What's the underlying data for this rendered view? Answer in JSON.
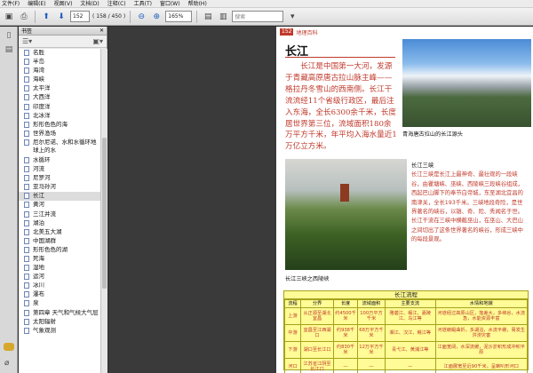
{
  "menu": [
    "文件(F)",
    "编辑(E)",
    "视图(V)",
    "文档(D)",
    "注释(C)",
    "工具(T)",
    "窗口(W)",
    "帮助(H)"
  ],
  "toolbar": {
    "page_current": "152",
    "page_total": "( 158 / 450 )",
    "zoom": "165%",
    "search_placeholder": "搜索"
  },
  "bookmarks_panel": {
    "title": "书签",
    "items": [
      {
        "label": "名胜"
      },
      {
        "label": "半岛"
      },
      {
        "label": "海湾"
      },
      {
        "label": "海峡"
      },
      {
        "label": "太平洋"
      },
      {
        "label": "大西洋"
      },
      {
        "label": "印度洋"
      },
      {
        "label": "北冰洋"
      },
      {
        "label": "形形色色的海"
      },
      {
        "label": "世界渔场"
      },
      {
        "label": "厄尔尼诺、水和水循环地球上的水"
      },
      {
        "label": "水循环"
      },
      {
        "label": "河流"
      },
      {
        "label": "尼罗河"
      },
      {
        "label": "亚马孙河"
      },
      {
        "label": "长江"
      },
      {
        "label": "黄河"
      },
      {
        "label": "三江并流"
      },
      {
        "label": "湖泊"
      },
      {
        "label": "北美五大湖"
      },
      {
        "label": "中国湖群"
      },
      {
        "label": "形形色色的湖"
      },
      {
        "label": "死海"
      },
      {
        "label": "湿地"
      },
      {
        "label": "运河"
      },
      {
        "label": "冰川"
      },
      {
        "label": "瀑布"
      },
      {
        "label": "泉"
      },
      {
        "label": "第四章 天气和气候大气层"
      },
      {
        "label": "太阳辐射"
      },
      {
        "label": "气象观测"
      }
    ]
  },
  "page": {
    "number": "152",
    "section": "地理百科",
    "title": "长江",
    "intro": "长江是中国第一大河，发源于青藏高原唐古拉山脉主峰——格拉丹冬雪山的西南侧。长江干流流经11个省级行政区，最后注入东海，全长6300余千米，长度居世界第三位，流域面积180余万平方千米，年平均入海水量近1万亿立方米。",
    "photo_top_caption": "青海唐古拉山的长江源头",
    "photo_bottom_caption": "长江三峡之西陵峡",
    "three_gorges_heading": "长江三峡",
    "three_gorges_text": "长江三峡是长江上最神奇、最壮观的一段峡谷，由瞿塘峡、巫峡、西陵峡三段峡谷组成，西起巴山脚下的奉节白帝城，东至湖北宜昌的南津关，全长193千米。三峡地段奇险，是世界著名的峡谷，以雄、奇、险、秀闻名于世。长江干流在三峡中横截巫山，在巫山、大巴山之间切出了这条世界著名的峡谷，形成三峡中的每段景观。",
    "table": {
      "title": "长江流程",
      "headers": [
        "流程",
        "分界",
        "长度",
        "流域面积",
        "主要支流",
        "水情和地貌"
      ],
      "rows": [
        [
          "上游",
          "从正源至湖北宜昌",
          "约4500千米",
          "100万平方千米",
          "雅砻江、岷江、嘉陵江、乌江等",
          "河道经过高原山区，落差大，多峡谷，水流急，水能资源丰富"
        ],
        [
          "中游",
          "宜昌至江西湖口",
          "约938千米",
          "68万平方千米",
          "湘江、汉江、赣江等",
          "河道蜿蜒曲折，多湖泊，水流平缓，易发生洪涝灾害"
        ],
        [
          "下游",
          "湖口至长江口",
          "约830千米",
          "12万平方千米",
          "青弋江、黄浦江等",
          "江面宽阔，水深流缓，泥沙淤积形成冲积平原"
        ],
        [
          "河口",
          "江苏省江阴至长江口",
          "—",
          "—",
          "—",
          "江面展宽至近90千米，呈喇叭形河口"
        ]
      ]
    }
  }
}
